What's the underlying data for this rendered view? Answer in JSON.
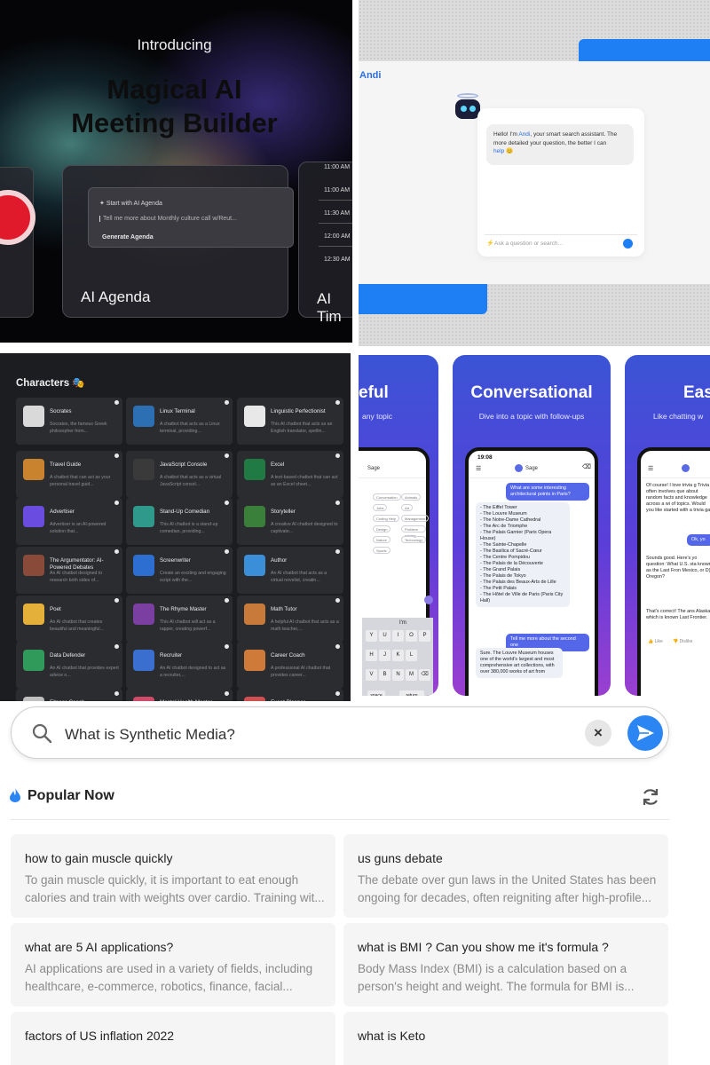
{
  "meeting": {
    "intro": "Introducing",
    "headline_line1": "Magical AI",
    "headline_line2": "Meeting Builder",
    "start_label": "Start with AI Agenda",
    "input_placeholder": "Tell me more about Monthly culture call w/Reut...",
    "generate_label": "Generate Agenda",
    "card_label": "AI Agenda",
    "second_card_label": "AI Tim",
    "times": [
      "11:00 AM",
      "11:00 AM",
      "11:30 AM",
      "12:00 AM",
      "12:30 AM"
    ]
  },
  "andi": {
    "brand": "Andi",
    "greeting_line1": "Hello! I'm ",
    "greeting_name": "Andi",
    "greeting_line1_rest": ", your smart search assistant. The",
    "greeting_line2": "more detailed your question, the better I can",
    "greeting_help": "help",
    "greeting_emoji": "😊",
    "ask_placeholder": "Ask a question or search..."
  },
  "characters": {
    "title": "Characters",
    "title_icon": "🎭",
    "items": [
      {
        "name": "Socrates",
        "desc": "Socrates, the famous Greek philosopher from..."
      },
      {
        "name": "Linux Terminal",
        "desc": "A chatbot that acts as a Linux terminal, providing..."
      },
      {
        "name": "Linguistic Perfectionist",
        "desc": "This AI chatbot that acts as an English translator, spellin..."
      },
      {
        "name": "Travel Guide",
        "desc": "A chatbot that can act as your personal travel guid..."
      },
      {
        "name": "JavaScript Console",
        "desc": "A chatbot that acts as a virtual JavaScript consol..."
      },
      {
        "name": "Excel",
        "desc": "A text-based chatbot that can act as an Excel sheet..."
      },
      {
        "name": "Advertiser",
        "desc": "Advertiser is an AI-powered solution that..."
      },
      {
        "name": "Stand-Up Comedian",
        "desc": "This AI chatbot is a stand-up comedian, providing..."
      },
      {
        "name": "Storyteller",
        "desc": "A creative AI chatbot designed to captivate..."
      },
      {
        "name": "The Argumentator: AI-Powered Debates",
        "desc": "An AI chatbot designed to research both sides of..."
      },
      {
        "name": "Screenwriter",
        "desc": "Create an exciting and engaging script with the..."
      },
      {
        "name": "Author",
        "desc": "An AI chatbot that acts as a virtual novelist, creatin..."
      },
      {
        "name": "Poet",
        "desc": "An AI chatbot that creates beautiful and meaningful..."
      },
      {
        "name": "The Rhyme Master",
        "desc": "This AI chatbot will act as a rapper, creating powerf..."
      },
      {
        "name": "Math Tutor",
        "desc": "A helpful AI chatbot that acts as a math teacher,..."
      },
      {
        "name": "Data Defender",
        "desc": "An AI chatbot that provides expert advice o..."
      },
      {
        "name": "Recruiter",
        "desc": "An AI chatbot designed to act as a recruiter,..."
      },
      {
        "name": "Career Coach",
        "desc": "A professional AI chatbot that provides career..."
      },
      {
        "name": "Fitness Coach",
        "desc": ""
      },
      {
        "name": "Mental Health Mentor",
        "desc": ""
      },
      {
        "name": "Event Planner",
        "desc": ""
      }
    ]
  },
  "promo": {
    "left_header": "eful",
    "left_sub": "any topic",
    "center_header": "Conversational",
    "center_sub": "Dive into a topic with follow-ups",
    "right_header": "Eas",
    "right_sub": "Like chatting w",
    "phone_time": "19:08",
    "phone_name": "Sage",
    "user_msg1": "What are some interesting architectural points in Paris?",
    "bot_list": "- The Eiffel Tower\n- The Louvre Museum\n- The Notre-Dame Cathedral\n- The Arc de Triomphe\n- The Palais Garnier (Paris Opera House)\n- The Sainte-Chapelle\n- The Basilica of Sacré-Cœur\n- The Centre Pompidou\n- The Palais de la Découverte\n- The Grand Palais\n- The Palais de Tokyo\n- The Palais des Beaux-Arts de Lille\n- The Petit Palais\n- The Hôtel de Ville de Paris (Paris City Hall)",
    "user_msg2": "Tell me more about the second one",
    "bot_msg2": "Sure. The Louvre Museum houses one of the world's largest and most comprehensive art collections, with over 380,000 works of art from",
    "right_msg1": "Of course! I love trivia g Trivia often involves que about random facts and knowledge across a wi of topics. Would you like started with a trivia gar",
    "right_msg2": "Ok, yo",
    "right_msg3": "Sounds good. Here's yo question: What U.S. sta known as the Last Fron Mexico, or D) Oregon?",
    "right_msg4": "That's correct! The ans Alaska, which is known Last Frontier.",
    "like": "Like",
    "dislike": "Dislike",
    "kbd_row1": [
      "Y",
      "U",
      "I",
      "O",
      "P"
    ],
    "kbd_row2": [
      "H",
      "J",
      "K",
      "L"
    ],
    "kbd_row3": [
      "V",
      "B",
      "N",
      "M",
      "⌫"
    ],
    "kbd_space": "space",
    "kbd_return": "return",
    "kbd_suggestion": "I'm",
    "chips": [
      "Conversation",
      "Animals",
      "Jobs",
      "Art",
      "Coding Help",
      "Management",
      "Design",
      "Problem solving",
      "Nature",
      "Technology",
      "Sports"
    ]
  },
  "search": {
    "query": "What is Synthetic Media?",
    "clear_label": "×",
    "popular_title": "Popular Now",
    "cards": [
      {
        "q": "how to gain muscle quickly",
        "a": "To gain muscle quickly, it is important to eat enough calories and train with weights over cardio. Training wit..."
      },
      {
        "q": "us guns debate",
        "a": "The debate over gun laws in the United States has been ongoing for decades, often reigniting after high-profile..."
      },
      {
        "q": "what are 5 AI applications?",
        "a": "AI applications are used in a variety of fields, including healthcare, e-commerce, robotics, finance, facial..."
      },
      {
        "q": "what is BMI ? Can you show me it's formula ?",
        "a": "Body Mass Index (BMI) is a calculation based on a person's height and weight. The formula for BMI is..."
      },
      {
        "q": "factors of US inflation 2022",
        "a": ""
      },
      {
        "q": "what is Keto",
        "a": ""
      }
    ]
  }
}
